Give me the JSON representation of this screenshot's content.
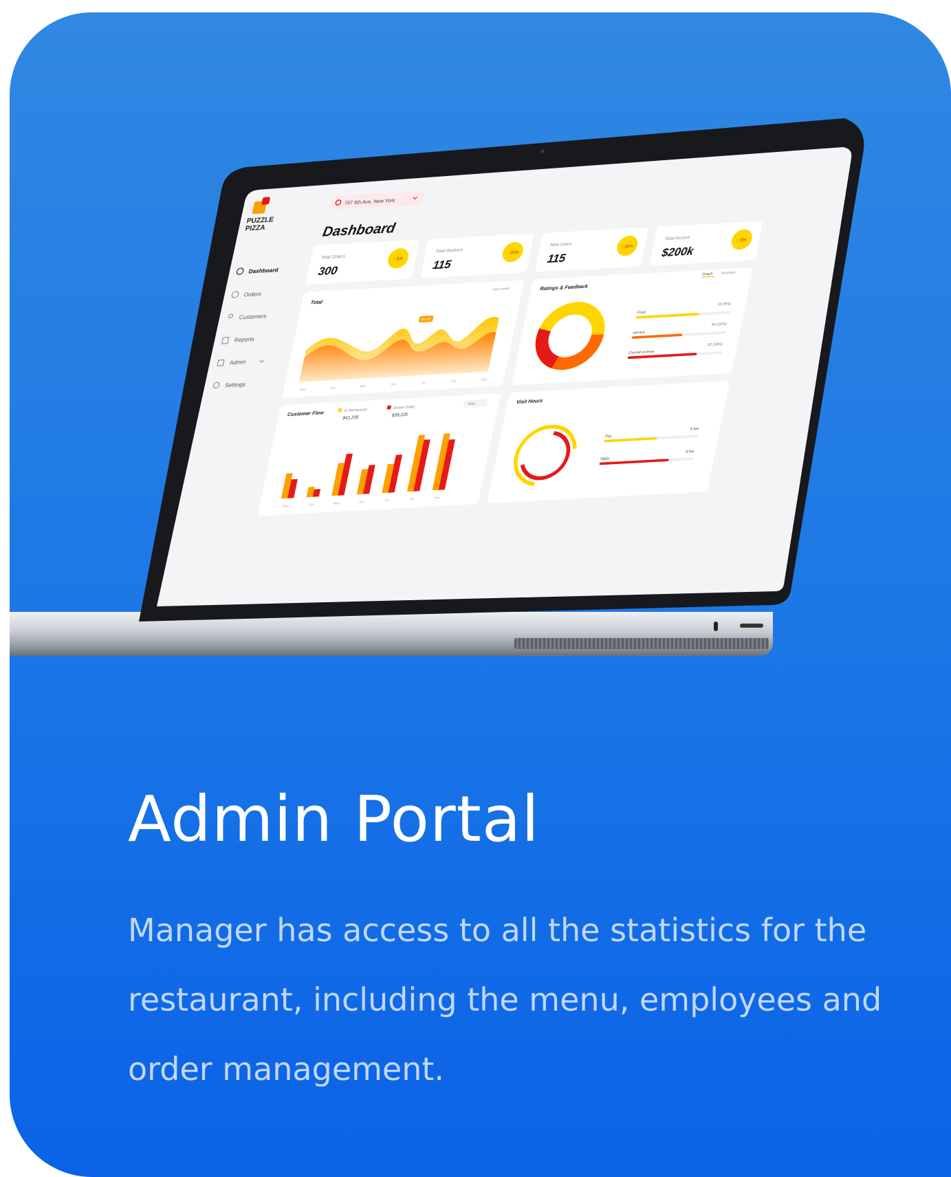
{
  "colors": {
    "card_top": "#3088e2",
    "card_bottom": "#0a62e6",
    "accent_yellow": "#ffd500",
    "accent_orange": "#ff8a00",
    "accent_red": "#e61919"
  },
  "dashboard": {
    "brand": [
      "PUZZLE",
      "PIZZA"
    ],
    "location": "767 5th Ave, New York",
    "title": "Dashboard",
    "nav": [
      {
        "label": "Dashboard",
        "icon": "dashboard-icon"
      },
      {
        "label": "Orders",
        "icon": "clock-icon"
      },
      {
        "label": "Customers",
        "icon": "user-icon"
      },
      {
        "label": "Reports",
        "icon": "report-icon"
      },
      {
        "label": "Admin",
        "icon": "grid-icon"
      },
      {
        "label": "Settings",
        "icon": "gear-icon"
      }
    ],
    "stats": [
      {
        "label": "Total Orders",
        "value": "300",
        "change": "↑ 8%"
      },
      {
        "label": "Total Workers",
        "value": "115",
        "change": "↑ 20%"
      },
      {
        "label": "New Users",
        "value": "115",
        "change": "↑ 30%"
      },
      {
        "label": "Total Income",
        "value": "$200k",
        "change": "↓ 8%"
      }
    ],
    "total_panel": {
      "title": "Total",
      "filter": "Last week",
      "badge": "$3,456"
    },
    "ratings_panel": {
      "title": "Ratings & Feedback",
      "tabs": [
        "Graph",
        "Reviews"
      ],
      "bars": [
        {
          "label": "Food",
          "value": "30 (5%)"
        },
        {
          "label": "service",
          "value": "40 (10%)"
        },
        {
          "label": "Overall reviews",
          "value": "20 (18%)"
        }
      ]
    },
    "flow_panel": {
      "title": "Customer Flow",
      "legend": [
        {
          "label": "In Restaurant",
          "value": "$41,235"
        },
        {
          "label": "Online Order",
          "value": "$39,225"
        }
      ],
      "filter": "Year"
    },
    "visit_panel": {
      "title": "Visit Hours",
      "rows": [
        {
          "label": "Day",
          "value": "5 hrs"
        },
        {
          "label": "Night",
          "value": "5 hrs"
        }
      ]
    },
    "days": [
      "Mon",
      "Tue",
      "Wed",
      "Thu",
      "Fri",
      "Sat",
      "Sun"
    ]
  },
  "hero": {
    "title": "Admin Portal",
    "description": "Manager has access to all the statistics for the restaurant, including the menu, employees and order management."
  }
}
